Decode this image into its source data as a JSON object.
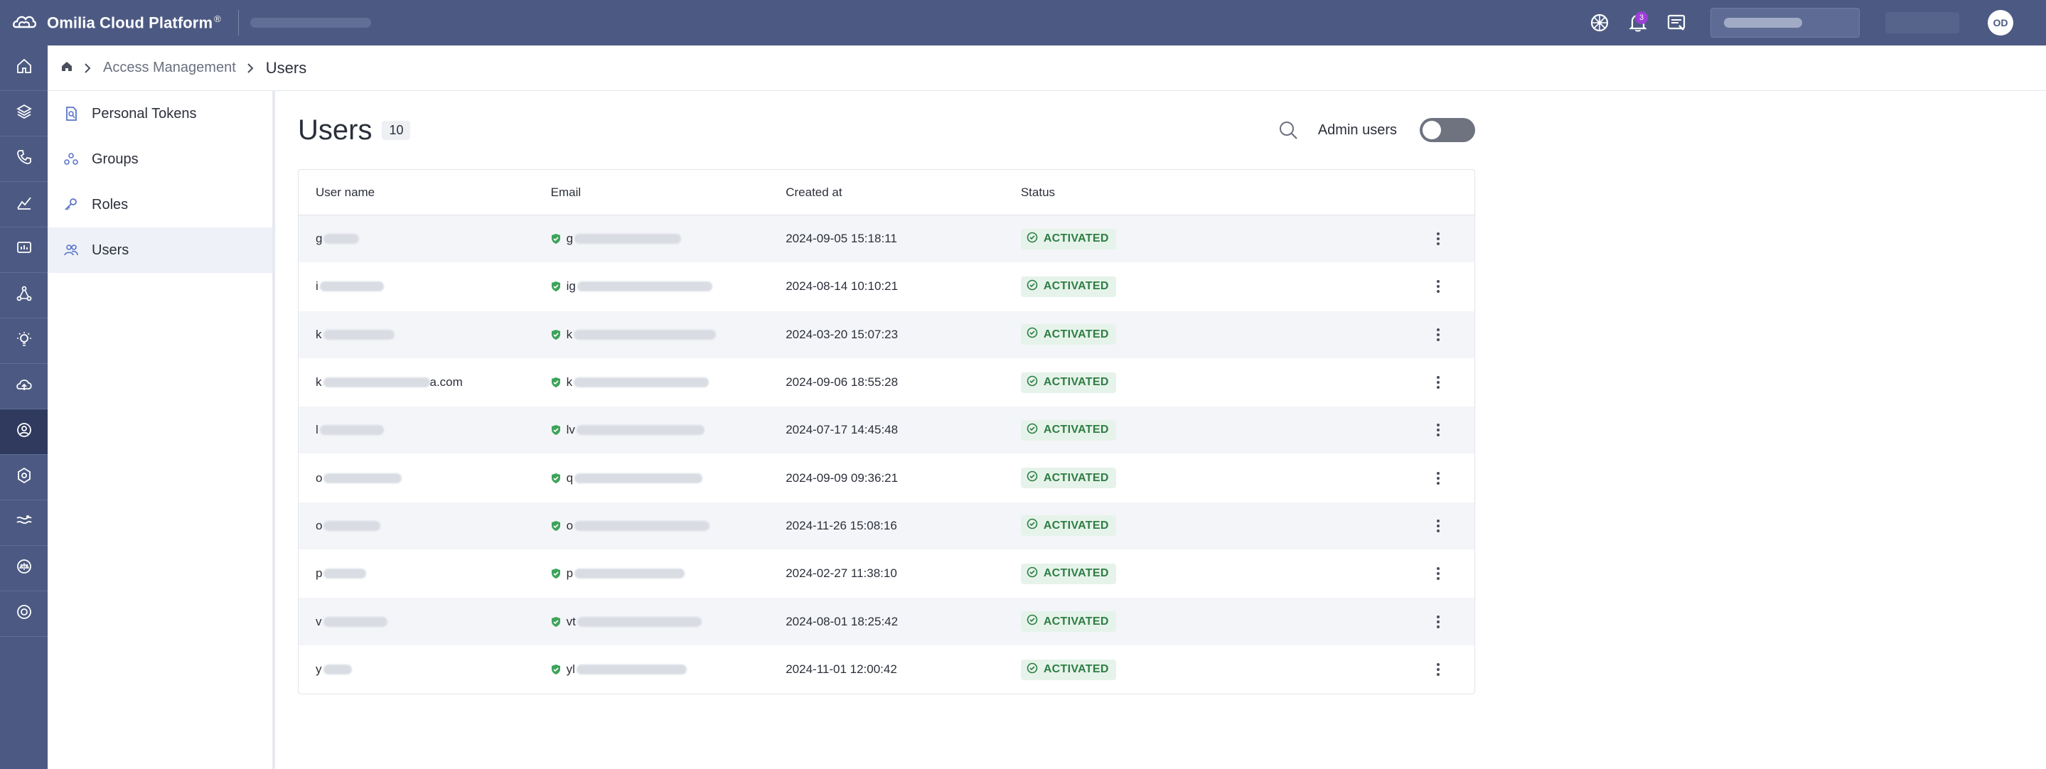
{
  "app": {
    "title": "Omilia Cloud Platform",
    "title_mark": "®",
    "notifications_count": "3",
    "avatar_initials": "OD"
  },
  "rail": {
    "items": [
      {
        "icon": "home-icon"
      },
      {
        "icon": "layers-icon"
      },
      {
        "icon": "phone-icon"
      },
      {
        "icon": "analytics-icon"
      },
      {
        "icon": "monitor-icon"
      },
      {
        "icon": "flow-icon"
      },
      {
        "icon": "bulb-icon"
      },
      {
        "icon": "cloud-upload-icon"
      },
      {
        "icon": "access-management-icon",
        "active": true
      },
      {
        "icon": "settings-icon"
      },
      {
        "icon": "tuning-icon"
      },
      {
        "icon": "balance-icon"
      },
      {
        "icon": "support-icon"
      }
    ]
  },
  "breadcrumb": {
    "parent": "Access Management",
    "current": "Users"
  },
  "subnav": {
    "items": [
      {
        "label": "Personal Tokens",
        "icon": "token-icon"
      },
      {
        "label": "Groups",
        "icon": "groups-icon"
      },
      {
        "label": "Roles",
        "icon": "key-icon"
      },
      {
        "label": "Users",
        "icon": "users-icon",
        "active": true
      }
    ]
  },
  "page": {
    "title": "Users",
    "count": "10",
    "admin_toggle_label": "Admin users",
    "admin_toggle_on": false
  },
  "table": {
    "columns": [
      "User name",
      "Email",
      "Created at",
      "Status"
    ],
    "rows": [
      {
        "user": "g",
        "email": "g",
        "created": "2024-09-05 15:18:11",
        "status": "ACTIVATED"
      },
      {
        "user": "i",
        "email": "ig",
        "created": "2024-08-14 10:10:21",
        "status": "ACTIVATED"
      },
      {
        "user": "k",
        "email": "k",
        "created": "2024-03-20 15:07:23",
        "status": "ACTIVATED"
      },
      {
        "user": "k",
        "user_suffix": "a.com",
        "email": "k",
        "created": "2024-09-06 18:55:28",
        "status": "ACTIVATED"
      },
      {
        "user": "l",
        "email": "lv",
        "created": "2024-07-17 14:45:48",
        "status": "ACTIVATED"
      },
      {
        "user": "o",
        "email": "q",
        "created": "2024-09-09 09:36:21",
        "status": "ACTIVATED"
      },
      {
        "user": "o",
        "email": "o",
        "created": "2024-11-26 15:08:16",
        "status": "ACTIVATED"
      },
      {
        "user": "p",
        "email": "p",
        "created": "2024-02-27 11:38:10",
        "status": "ACTIVATED"
      },
      {
        "user": "v",
        "email": "vt",
        "created": "2024-08-01 18:25:42",
        "status": "ACTIVATED"
      },
      {
        "user": "y",
        "email": "yl",
        "created": "2024-11-01 12:00:42",
        "status": "ACTIVATED"
      }
    ]
  },
  "colors": {
    "topbar": "#4c5a83",
    "rail_active": "#2f3a5e",
    "status_green": "#2e7d44",
    "status_bg": "#e6f3ea",
    "badge_purple": "#9c3fd6"
  }
}
